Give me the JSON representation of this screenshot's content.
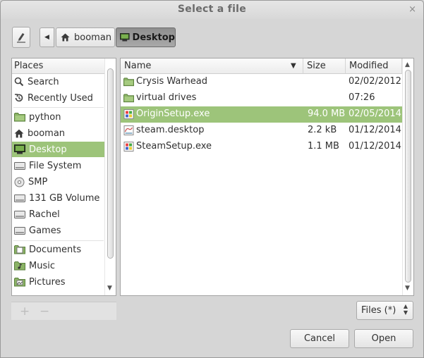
{
  "window": {
    "title": "Select a file",
    "close_glyph": "×"
  },
  "toolbar": {
    "edit_icon": "pencil-icon",
    "back_glyph": "◀",
    "path": [
      "booman",
      "Desktop"
    ]
  },
  "places": {
    "header": "Places",
    "items": [
      {
        "label": "Search",
        "icon": "search-icon"
      },
      {
        "label": "Recently Used",
        "icon": "recent-icon"
      },
      {
        "label": "python",
        "icon": "folder-icon"
      },
      {
        "label": "booman",
        "icon": "home-icon"
      },
      {
        "label": "Desktop",
        "icon": "desktop-icon",
        "selected": true
      },
      {
        "label": "File System",
        "icon": "drive-icon"
      },
      {
        "label": "SMP",
        "icon": "disc-icon"
      },
      {
        "label": "131 GB Volume",
        "icon": "drive-icon"
      },
      {
        "label": "Rachel",
        "icon": "drive-icon"
      },
      {
        "label": "Games",
        "icon": "drive-icon"
      },
      {
        "label": "Documents",
        "icon": "documents-folder-icon"
      },
      {
        "label": "Music",
        "icon": "music-folder-icon"
      },
      {
        "label": "Pictures",
        "icon": "pictures-folder-icon"
      }
    ],
    "add_glyph": "+",
    "remove_glyph": "−"
  },
  "files": {
    "columns": {
      "name": "Name",
      "size": "Size",
      "modified": "Modified"
    },
    "rows": [
      {
        "name": "Crysis Warhead",
        "size": "",
        "modified": "02/02/2012",
        "icon": "folder-icon"
      },
      {
        "name": "virtual drives",
        "size": "",
        "modified": "07:26",
        "icon": "folder-icon"
      },
      {
        "name": "OriginSetup.exe",
        "size": "94.0 MB",
        "modified": "02/05/2014",
        "icon": "exe-icon",
        "selected": true
      },
      {
        "name": "steam.desktop",
        "size": "2.2 kB",
        "modified": "01/12/2014",
        "icon": "desktop-file-icon"
      },
      {
        "name": "SteamSetup.exe",
        "size": "1.1 MB",
        "modified": "01/12/2014",
        "icon": "exe-icon"
      }
    ]
  },
  "filter": {
    "value": "Files (*)"
  },
  "buttons": {
    "cancel": "Cancel",
    "open": "Open"
  },
  "colors": {
    "selection": "#9dc47a",
    "folder": "#8bb366",
    "window_bg": "#d6d6d6"
  }
}
